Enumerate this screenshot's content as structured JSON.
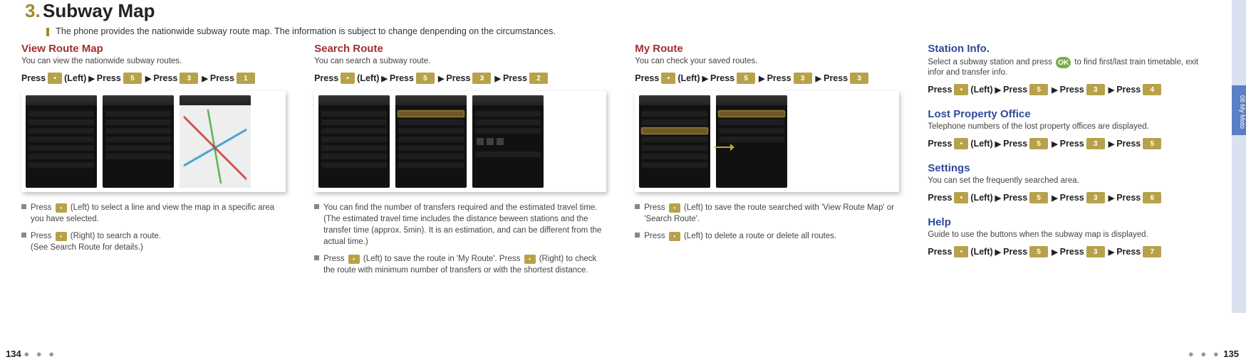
{
  "header": {
    "num": "3.",
    "title": "Subway Map",
    "intro": "The phone provides the nationwide subway route map. The information is subject to change denpending on the circumstances."
  },
  "press_labels": {
    "press": "Press",
    "left": "(Left)",
    "right": "(Right)",
    "arrow": "▶",
    "key5": "5",
    "key3": "3",
    "key1": "1",
    "key2": "2",
    "key4": "4",
    "key6": "6",
    "key7": "7",
    "dot": "•",
    "ok": "OK"
  },
  "col1": {
    "title": "View Route Map",
    "sub": "You can view the nationwide subway routes.",
    "notes": [
      "Press (Left) to select a line and view the map in a specific area you have selected.",
      "Press (Right) to search a route. (See Search Route for details.)"
    ]
  },
  "col2": {
    "title": "Search Route",
    "sub": "You can search a subway route.",
    "notes": [
      "You can find the number of transfers required and the estimated travel time. (The estimated travel time includes the distance beween stations and the transfer time (approx. 5min). It is an estimation, and can be different from the actual time.)",
      "Press (Left) to save the route in 'My Route'. Press (Right) to check the route with minimum number of transfers or with the shortest distance."
    ]
  },
  "col3": {
    "title": "My Route",
    "sub": "You can check your saved routes.",
    "notes": [
      "Press (Left) to save the route searched with 'View Route Map' or 'Search Route'.",
      "Press (Left) to delete a route or delete all routes."
    ]
  },
  "col4": {
    "station": {
      "title": "Station Info.",
      "sub": "Select a subway station and press to find first/last train timetable, exit infor and transfer info."
    },
    "lost": {
      "title": "Lost Property Office",
      "sub": "Telephone numbers of the lost property offices are displayed."
    },
    "settings": {
      "title": "Settings",
      "sub": "You can set the frequently searched area."
    },
    "help": {
      "title": "Help",
      "sub": "Guide to use the buttons when the subway map is displayed."
    }
  },
  "sidebar": {
    "label": "08  My Moto"
  },
  "pages": {
    "left": "134",
    "right": "135"
  }
}
